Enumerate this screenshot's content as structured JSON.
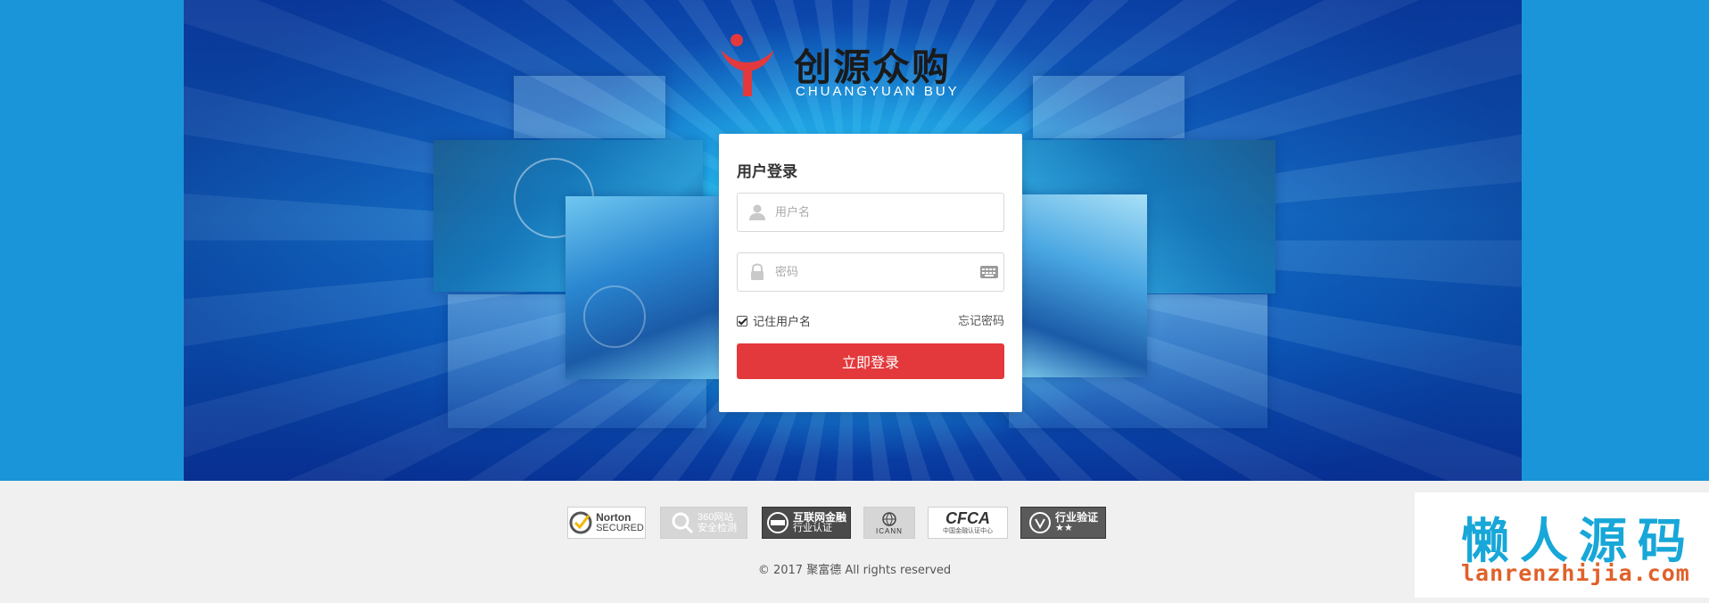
{
  "logo": {
    "brand_cn": "创源众购",
    "brand_en": "CHUANGYUAN BUY",
    "mark_color": "#e3393c"
  },
  "login": {
    "title": "用户登录",
    "username_placeholder": "用户名",
    "username_value": "",
    "password_placeholder": "密码",
    "password_value": "",
    "remember_label": "记住用户名",
    "remember_checked": true,
    "forgot_label": "忘记密码",
    "submit_label": "立即登录",
    "submit_color": "#e3393c"
  },
  "footer": {
    "badges": [
      {
        "icon": "norton-check-icon",
        "title": "Norton",
        "sub": "SECURED"
      },
      {
        "icon": "magnifier-icon",
        "title": "360网站",
        "sub": "安全检测"
      },
      {
        "icon": "seal-icon",
        "title": "互联网金融",
        "sub": "行业认证"
      },
      {
        "icon": "icann-globe-icon",
        "title": "ICANN",
        "sub": ""
      },
      {
        "icon": "cfca-icon",
        "title": "CFCA",
        "sub": "中国金融认证中心"
      },
      {
        "icon": "verified-icon",
        "title": "行业验证",
        "sub": "★★"
      }
    ],
    "copyright": "© 2017 聚富德 All rights reserved"
  },
  "watermark": {
    "cn": "懒人源码",
    "en": "lanrenzhijia.com"
  }
}
